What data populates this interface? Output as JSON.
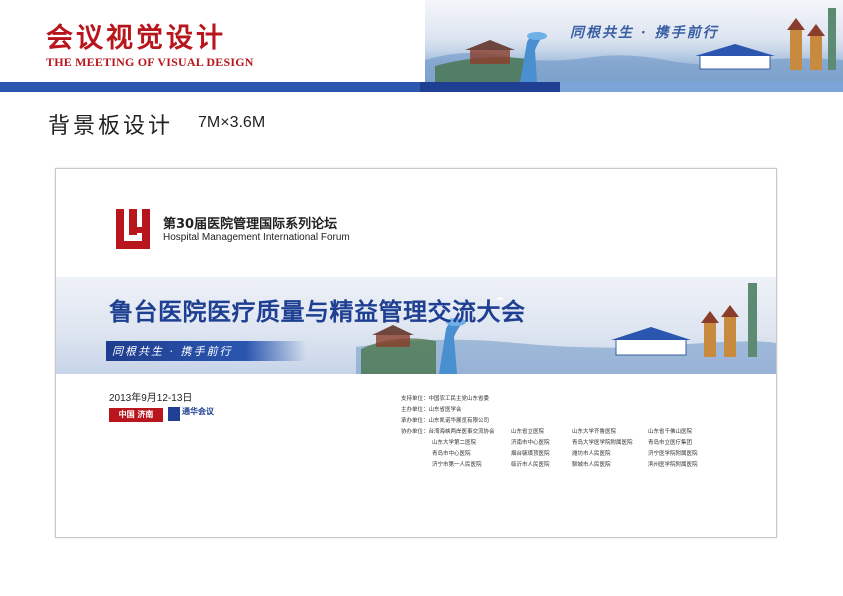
{
  "header": {
    "title_cn": "会议视觉设计",
    "title_en": "THE MEETING OF VISUAL DESIGN",
    "slogan": "同根共生 · 携手前行"
  },
  "section": {
    "title": "背景板设计",
    "size": "7M×3.6M"
  },
  "board": {
    "forum_cn": "第30届医院管理国际系列论坛",
    "forum_en": "Hospital Management International Forum",
    "main_title": "鲁台医院医疗质量与精益管理交流大会",
    "slogan": "同根共生 · 携手前行",
    "date": "2013年9月12-13日",
    "badge_red": "中国 济南",
    "badge_logo": "通华会议",
    "organizers": [
      "支持单位：中国农工民主党山东省委",
      "主办单位：山东省医学会",
      "承办单位：山东凯诺华展览有限公司",
      "协办单位：台湾海峡两岸医事交流协会"
    ],
    "cooperators": [
      [
        "山东省立医院",
        "山东大学齐鲁医院",
        "山东省千佛山医院"
      ],
      [
        "山东大学第二医院",
        "济南市中心医院",
        "青岛大学医学院附属医院",
        "青岛市立医疗集团"
      ],
      [
        "青岛市中心医院",
        "烟台毓璜顶医院",
        "潍坊市人民医院",
        "济宁医学院附属医院"
      ],
      [
        "济宁市第一人民医院",
        "临沂市人民医院",
        "聊城市人民医院",
        "滨州医学院附属医院"
      ]
    ]
  },
  "colors": {
    "brand_red": "#b8161c",
    "brand_blue": "#1e3f92"
  }
}
